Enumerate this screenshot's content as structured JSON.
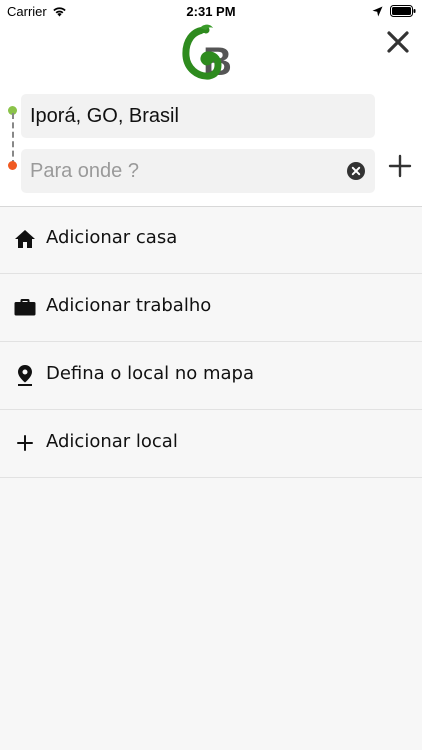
{
  "status_bar": {
    "carrier": "Carrier",
    "time": "2:31 PM"
  },
  "header": {
    "logo_text": "GB",
    "colors": {
      "origin_dot": "#8bc34a",
      "destination_dot": "#f05a22"
    }
  },
  "route": {
    "origin_value": "Iporá, GO, Brasil",
    "destination_value": "",
    "destination_placeholder": "Para onde ?"
  },
  "places": [
    {
      "icon": "home-icon",
      "label": "Adicionar casa"
    },
    {
      "icon": "briefcase-icon",
      "label": "Adicionar trabalho"
    },
    {
      "icon": "map-pin-icon",
      "label": "Defina o local no mapa"
    },
    {
      "icon": "plus-icon",
      "label": "Adicionar local"
    }
  ]
}
